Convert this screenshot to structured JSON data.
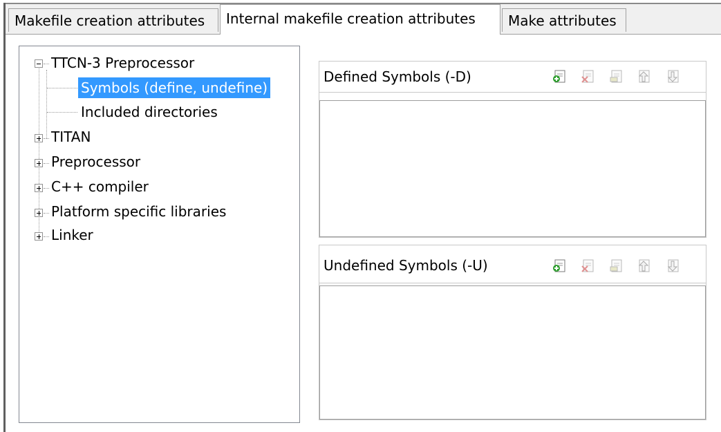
{
  "tabs": [
    {
      "label": "Makefile creation attributes"
    },
    {
      "label": "Internal makefile creation attributes"
    },
    {
      "label": "Make attributes"
    }
  ],
  "tree": {
    "nodes": [
      {
        "label": "TTCN-3 Preprocessor",
        "expanded": true
      },
      {
        "label": "Symbols (define, undefine)",
        "selected": true
      },
      {
        "label": "Included directories"
      },
      {
        "label": "TITAN"
      },
      {
        "label": "Preprocessor"
      },
      {
        "label": "C++ compiler"
      },
      {
        "label": "Platform specific libraries"
      },
      {
        "label": "Linker"
      }
    ]
  },
  "defined": {
    "title": "Defined Symbols (-D)",
    "tools": [
      "add-icon",
      "delete-icon",
      "edit-icon",
      "move-up-icon",
      "move-down-icon"
    ]
  },
  "undefined": {
    "title": "Undefined Symbols (-U)",
    "tools": [
      "add-icon",
      "delete-icon",
      "edit-icon",
      "move-up-icon",
      "move-down-icon"
    ]
  },
  "colors": {
    "selection": "#3399ff",
    "add_green": "#2e9e2e"
  }
}
